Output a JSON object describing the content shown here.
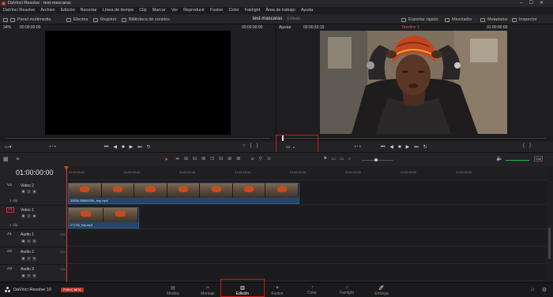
{
  "titlebar": {
    "title": "DaVinci Resolve - test-mascaras"
  },
  "menu": [
    "DaVinci Resolve",
    "Archivo",
    "Edición",
    "Recortar",
    "Línea de tiempo",
    "Clip",
    "Marcar",
    "Ver",
    "Reproducir",
    "Fusion",
    "Color",
    "Fairlight",
    "Área de trabajo",
    "Ayuda"
  ],
  "toolbar": {
    "media_pool": "Panel multimedia",
    "effects": "Efectos",
    "edit_index": "Registro",
    "sound_library": "Biblioteca de sonidos",
    "project_name": "test-mascaras",
    "project_state": "Editado",
    "quick_export": "Exportar rápido",
    "mixer": "Mezclador",
    "metadata": "Metadatos",
    "inspector": "Inspector"
  },
  "viewer_left": {
    "zoom": "34%",
    "timecode": "00:00:00:00",
    "timecode_right": "00:00:00:00"
  },
  "viewer_right": {
    "zoom": "Ajustar",
    "timecode": "00:00:33:15",
    "timeline_name": "Timeline 1",
    "timecode_right": "01:00:00:00"
  },
  "tooltip": "Transformar",
  "timeline": {
    "current_timecode": "01:00:00:00",
    "ruler": [
      "01:00:00:00",
      "01:00:05:00",
      "01:00:10:00",
      "01:00:15:00",
      "01:00:20:00",
      "01:00:25:00",
      "01:00:30:00",
      "01:00:35:00"
    ],
    "volume_label": "DIM",
    "tracks": [
      {
        "tag": "V2",
        "name": "Video 2",
        "clips": "1 clip"
      },
      {
        "tag": "V1",
        "name": "Video 1",
        "clips": "1 clip"
      },
      {
        "tag": "A1",
        "name": "Audio 1",
        "db": "0.0"
      },
      {
        "tag": "A2",
        "name": "Audio 2",
        "db": "0.0"
      },
      {
        "tag": "A3",
        "name": "Audio 3",
        "db": "0.0"
      }
    ],
    "clips": {
      "v2": "32658-09564538L_tmp.mp4",
      "v1": "2717M_tmp.mp4"
    }
  },
  "bottom": {
    "app_name": "DaVinci Resolve 19",
    "badge": "PUBLIC BETA",
    "pages": [
      "Medios",
      "Montaje",
      "Edición",
      "Fusion",
      "Color",
      "Fairlight",
      "Entrega"
    ],
    "active_page": "Edición"
  },
  "colors": {
    "accent_red": "#e01010",
    "playhead": "#e03a2f",
    "clip_blue": "#23456b"
  }
}
